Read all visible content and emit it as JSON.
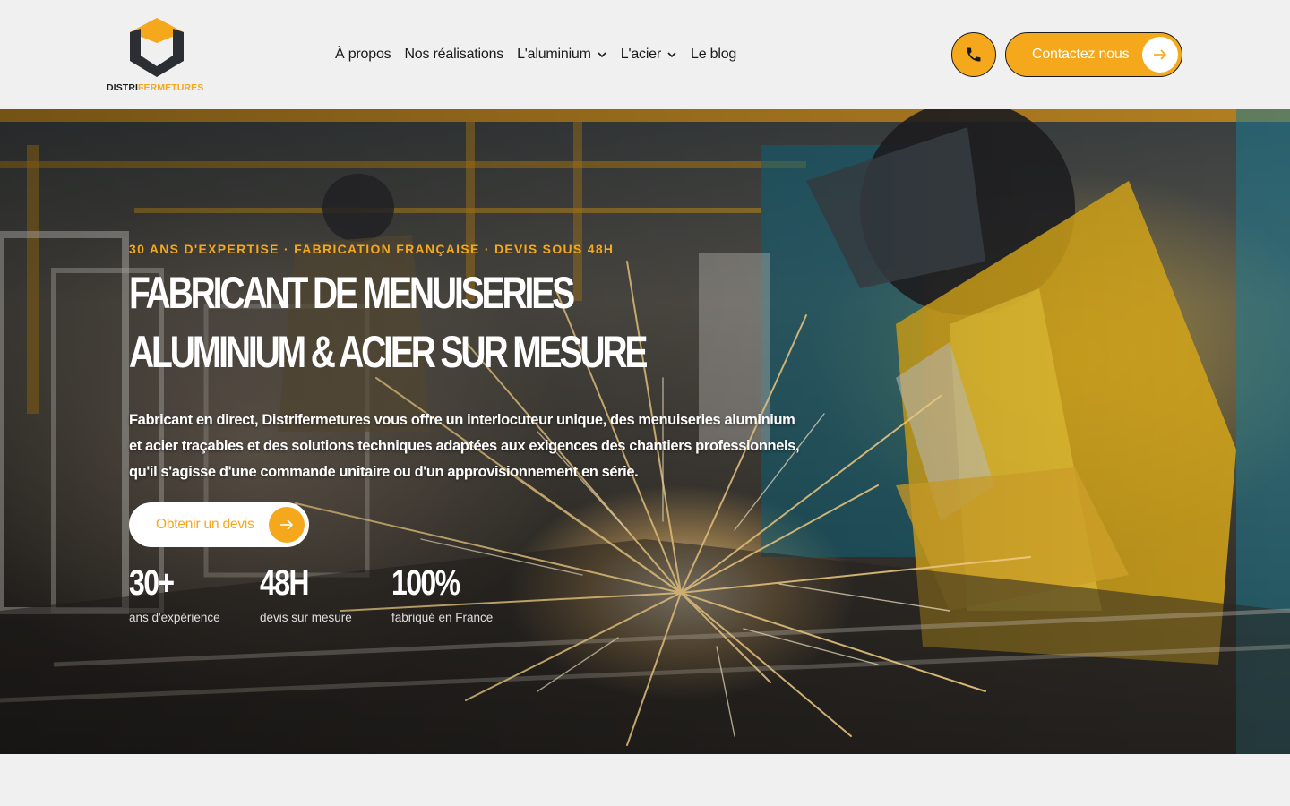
{
  "brand": {
    "name_part1": "DISTRI",
    "name_part2": "FERMETURES",
    "colors": {
      "accent": "#f5a81b",
      "dark": "#1c1c1c",
      "background": "#f0f0f0"
    }
  },
  "nav": {
    "items": [
      {
        "label": "À propos",
        "has_dropdown": false
      },
      {
        "label": "Nos réalisations",
        "has_dropdown": false
      },
      {
        "label": "L'aluminium",
        "has_dropdown": true
      },
      {
        "label": "L'acier",
        "has_dropdown": true
      },
      {
        "label": "Le blog",
        "has_dropdown": false
      }
    ]
  },
  "header": {
    "phone_icon": "phone-icon",
    "contact_label": "Contactez nous",
    "contact_icon": "arrow-right-icon"
  },
  "hero": {
    "eyebrow": "30 ANS D'EXPERTISE · FABRICATION FRANÇAISE · DEVIS SOUS 48H",
    "title_line1": "FABRICANT DE MENUISERIES",
    "title_line2": "ALUMINIUM & ACIER SUR MESURE",
    "description": "Fabricant en direct, Distrifermetures vous offre un interlocuteur unique, des menuiseries aluminium et acier traçables et des solutions techniques adaptées aux exigences des chantiers professionnels, qu'il s'agisse d'une commande unitaire ou d'un approvisionnement en série.",
    "cta_label": "Obtenir un devis",
    "cta_icon": "arrow-right-icon",
    "stats": [
      {
        "value": "30+",
        "caption": "ans d'expérience"
      },
      {
        "value": "48H",
        "caption": "devis sur mesure"
      },
      {
        "value": "100%",
        "caption": "fabriqué en France"
      }
    ]
  }
}
